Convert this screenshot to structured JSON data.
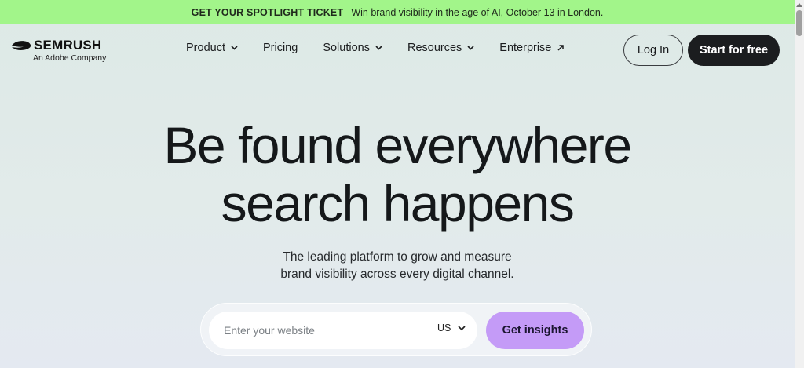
{
  "promo": {
    "ticket": "GET YOUR SPOTLIGHT TICKET",
    "message": "Win brand visibility in the age of AI, October 13 in London."
  },
  "logo": {
    "name": "SEMRUSH",
    "tagline": "An Adobe Company"
  },
  "nav": {
    "items": [
      {
        "label": "Product",
        "icon": "chevron-down-icon"
      },
      {
        "label": "Pricing",
        "icon": ""
      },
      {
        "label": "Solutions",
        "icon": "chevron-down-icon"
      },
      {
        "label": "Resources",
        "icon": "chevron-down-icon"
      },
      {
        "label": "Enterprise",
        "icon": "arrow-up-right-icon"
      }
    ],
    "login_label": "Log In",
    "start_label": "Start for free"
  },
  "hero": {
    "title_line1": "Be found everywhere",
    "title_line2": "search happens",
    "subtitle_line1": "The leading platform to grow and measure",
    "subtitle_line2": "brand visibility across every digital channel."
  },
  "search": {
    "placeholder": "Enter your website",
    "value": "",
    "country": "US",
    "submit_label": "Get insights"
  },
  "colors": {
    "promo_bg": "#a2f58a",
    "dark_button": "#1b1d1f",
    "accent_purple": "#c49bf7"
  }
}
